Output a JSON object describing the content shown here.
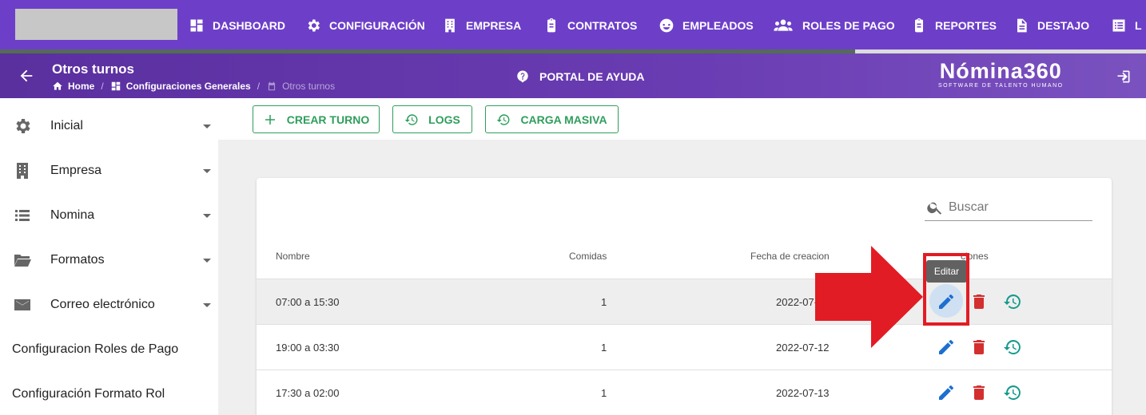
{
  "topnav": {
    "items": [
      {
        "label": "DASHBOARD",
        "icon": "dashboard-icon"
      },
      {
        "label": "CONFIGURACIÓN",
        "icon": "gear-icon"
      },
      {
        "label": "EMPRESA",
        "icon": "building-icon"
      },
      {
        "label": "CONTRATOS",
        "icon": "clipboard-icon"
      },
      {
        "label": "EMPLEADOS",
        "icon": "face-icon"
      },
      {
        "label": "ROLES DE PAGO",
        "icon": "group-icon"
      },
      {
        "label": "REPORTES",
        "icon": "clipboard-list-icon"
      },
      {
        "label": "DESTAJO",
        "icon": "document-icon"
      },
      {
        "label": "L",
        "icon": "list-icon"
      }
    ]
  },
  "header": {
    "title": "Otros turnos",
    "breadcrumb": [
      "Home",
      "Configuraciones Generales",
      "Otros turnos"
    ],
    "help_label": "PORTAL DE AYUDA",
    "brand_name": "Nómina360",
    "brand_tagline": "SOFTWARE DE TALENTO HUMANO"
  },
  "sidebar": {
    "items": [
      {
        "label": "Inicial",
        "icon": "gear-icon"
      },
      {
        "label": "Empresa",
        "icon": "building-icon"
      },
      {
        "label": "Nomina",
        "icon": "list-icon"
      },
      {
        "label": "Formatos",
        "icon": "folder-icon"
      },
      {
        "label": "Correo electrónico",
        "icon": "mail-icon"
      },
      {
        "label": "Configuracion Roles de Pago"
      },
      {
        "label": "Configuración Formato Rol"
      }
    ]
  },
  "toolbar": {
    "create_label": "CREAR TURNO",
    "logs_label": "LOGS",
    "bulk_label": "CARGA MASIVA"
  },
  "search": {
    "placeholder": "Buscar"
  },
  "table": {
    "columns": [
      "Nombre",
      "Comidas",
      "Fecha de creacion",
      "Acciones"
    ],
    "visible_actions_header": "ciones",
    "rows": [
      {
        "nombre": "07:00 a 15:30",
        "comidas": "1",
        "fecha": "2022-07-"
      },
      {
        "nombre": "19:00 a 03:30",
        "comidas": "1",
        "fecha": "2022-07-12"
      },
      {
        "nombre": "17:30 a 02:00",
        "comidas": "1",
        "fecha": "2022-07-13"
      }
    ]
  },
  "tooltip": {
    "label": "Editar"
  },
  "colors": {
    "nav_bg": "#6d3fc8",
    "accent_green": "#2f9e5c",
    "edit_blue": "#1e6fd0",
    "delete_red": "#d32f2f",
    "history_teal": "#159a8c",
    "annotation_red": "#e21c24"
  }
}
